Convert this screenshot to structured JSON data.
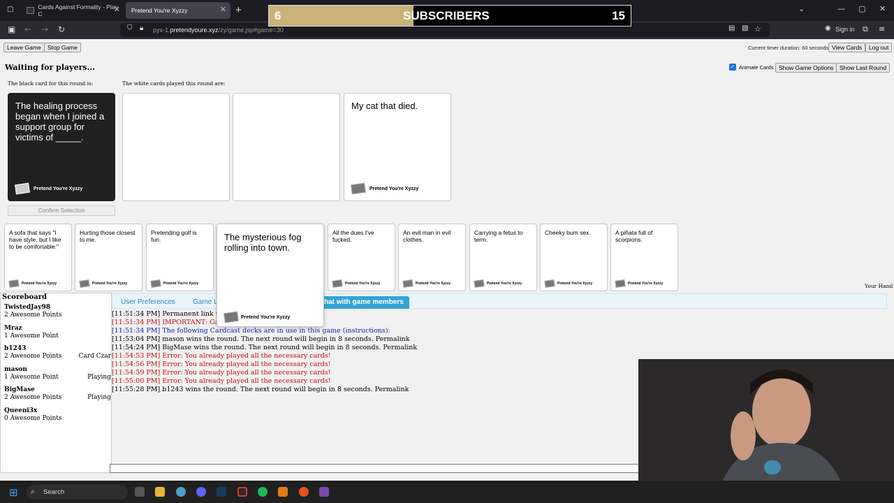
{
  "browser": {
    "tabs": [
      {
        "title": "Cards Against Formality - Play C",
        "active": false
      },
      {
        "title": "Pretend You're Xyzzy",
        "active": true
      }
    ],
    "url_prefix": "pyx-1.",
    "url_domain": "pretendyoure.xyz",
    "url_path": "/zy/game.jsp#game=30",
    "sign_in": "Sign in"
  },
  "overlay": {
    "count": "6",
    "label": "SUBSCRIBERS",
    "goal": "15",
    "progress": 0.4
  },
  "toolbar": {
    "leave": "Leave Game",
    "stop": "Stop Game",
    "timer": "Current timer duration: 60 seconds",
    "view_cards": "View Cards",
    "logout": "Log out"
  },
  "game": {
    "status": "Waiting for players...",
    "animate_label": "Animate Cards",
    "show_options": "Show Game Options",
    "show_last": "Show Last Round",
    "black_label": "The black card for this round is:",
    "white_label": "The white cards played this round are:",
    "black_card": "The healing process began when I joined a support group for victims of _____.",
    "played_card": "My cat that died.",
    "watermark": "Pretend You're Xyzzy",
    "confirm": "Confirm Selection",
    "your_hand": "Your Hand"
  },
  "hand": [
    "A sofa that says \"I have style, but I like to be comfortable.\"",
    "Hurting those closest to me.",
    "Pretending golf is fun.",
    "The mysterious fog rolling into town.",
    "All the dues I've fucked.",
    "An evil man in evil clothes.",
    "Carrying a fetus to term.",
    "Cheeky bum sex.",
    "A piñata full of scorpions."
  ],
  "scoreboard": {
    "title": "Scoreboard",
    "players": [
      {
        "name": "TwistedJay98",
        "points": "2 Awesome Points",
        "status": ""
      },
      {
        "name": "Mraz",
        "points": "1 Awesome Point",
        "status": ""
      },
      {
        "name": "b1243",
        "points": "2 Awesome Points",
        "status": "Card Czar"
      },
      {
        "name": "mason",
        "points": "1 Awesome Point",
        "status": "Playing"
      },
      {
        "name": "BigMase",
        "points": "2 Awesome Points",
        "status": "Playing"
      },
      {
        "name": "Queeni3x",
        "points": "0 Awesome Points",
        "status": ""
      }
    ]
  },
  "panel_tabs": {
    "prefs": "User Preferences",
    "game": "Game L",
    "chat": "hat with game members"
  },
  "log": [
    {
      "time": "[11:51:34 PM]",
      "text": "Permanent link to th",
      "cls": ""
    },
    {
      "time": "[11:51:34 PM]",
      "text": "IMPORTANT: Gam",
      "cls": "err"
    },
    {
      "time": "[11:51:34 PM]",
      "text": "The following Cardcast decks are in use in this game (instructions):",
      "cls": "blue"
    },
    {
      "time": "[11:53:04 PM]",
      "text": "mason wins the round. The next round will begin in 8 seconds. Permalink",
      "cls": ""
    },
    {
      "time": "[11:54:24 PM]",
      "text": "BigMase wins the round. The next round will begin in 8 seconds. Permalink",
      "cls": ""
    },
    {
      "time": "[11:54:53 PM]",
      "text": "Error: You already played all the necessary cards!",
      "cls": "err"
    },
    {
      "time": "[11:54:56 PM]",
      "text": "Error: You already played all the necessary cards!",
      "cls": "err"
    },
    {
      "time": "[11:54:59 PM]",
      "text": "Error: You already played all the necessary cards!",
      "cls": "err"
    },
    {
      "time": "[11:55:00 PM]",
      "text": "Error: You already played all the necessary cards!",
      "cls": "err"
    },
    {
      "time": "[11:55:28 PM]",
      "text": "b1243 wins the round. The next round will begin in 8 seconds. Permalink",
      "cls": ""
    }
  ],
  "taskbar": {
    "search": "Search"
  },
  "colors": {
    "accent": "#2a8ab8",
    "error": "#c01010",
    "black_card": "#202020"
  }
}
